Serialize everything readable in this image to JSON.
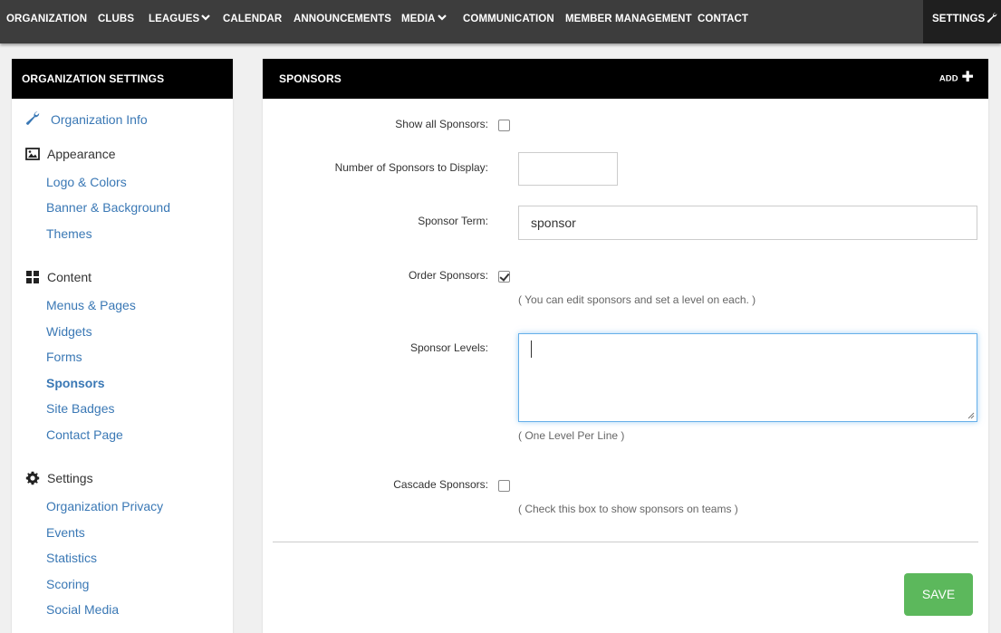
{
  "topnav": {
    "items": [
      {
        "label": "ORGANIZATION"
      },
      {
        "label": "CLUBS"
      },
      {
        "label": "LEAGUES",
        "icon": "chevron-down-icon"
      },
      {
        "label": "CALENDAR"
      },
      {
        "label": "ANNOUNCEMENTS"
      },
      {
        "label": "MEDIA",
        "icon": "chevron-down-icon"
      },
      {
        "label": "COMMUNICATION"
      },
      {
        "label": "MEMBER MANAGEMENT"
      },
      {
        "label": "CONTACT"
      }
    ],
    "settings_label": "SETTINGS",
    "settings_icon": "wrench-icon"
  },
  "sidebar": {
    "title": "ORGANIZATION SETTINGS",
    "org_info": {
      "label": "Organization Info",
      "icon": "wrench-icon"
    },
    "appearance": {
      "label": "Appearance",
      "icon": "image-icon",
      "links": [
        "Logo & Colors",
        "Banner & Background",
        "Themes"
      ]
    },
    "content": {
      "label": "Content",
      "icon": "grid-icon",
      "links": [
        "Menus & Pages",
        "Widgets",
        "Forms",
        "Sponsors",
        "Site Badges",
        "Contact Page"
      ],
      "active": "Sponsors"
    },
    "settings": {
      "label": "Settings",
      "icon": "gear-icon",
      "links": [
        "Organization Privacy",
        "Events",
        "Statistics",
        "Scoring",
        "Social Media"
      ]
    }
  },
  "main": {
    "title": "SPONSORS",
    "add_label": "ADD",
    "form": {
      "show_all": {
        "label": "Show all Sponsors:",
        "checked": false
      },
      "num_display": {
        "label": "Number of Sponsors to Display:",
        "value": ""
      },
      "term": {
        "label": "Sponsor Term:",
        "value": "sponsor"
      },
      "order": {
        "label": "Order Sponsors:",
        "checked": true,
        "help": "( You can edit sponsors and set a level on each. )"
      },
      "levels": {
        "label": "Sponsor Levels:",
        "value": "",
        "help": "( One Level Per Line )"
      },
      "cascade": {
        "label": "Cascade Sponsors:",
        "checked": false,
        "help": "( Check this box to show sponsors on teams )"
      }
    },
    "save_label": "SAVE"
  },
  "colors": {
    "nav_bg": "#3d3d3d",
    "settings_bg": "#1f1f1f",
    "link": "#3a78b5",
    "save": "#5cb85c",
    "focus": "#66afe9"
  }
}
